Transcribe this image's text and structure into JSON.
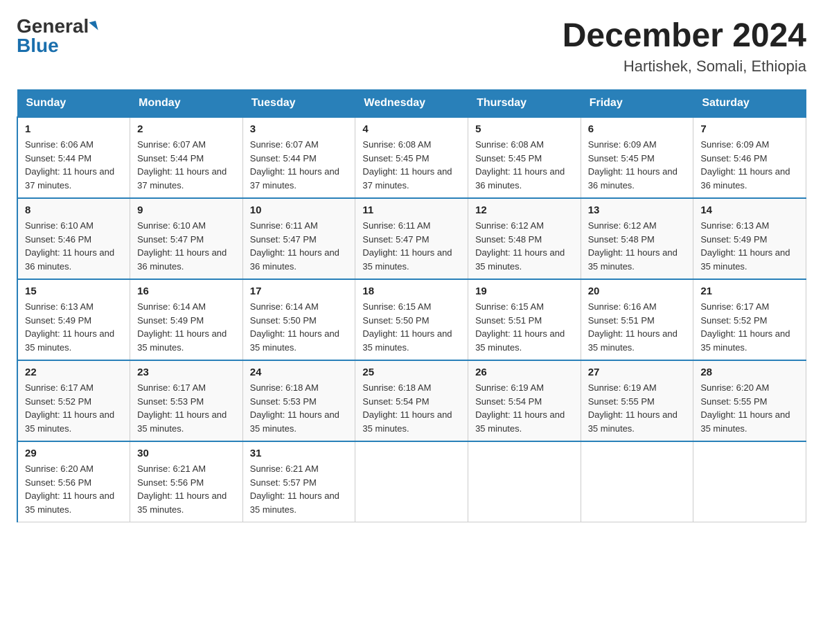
{
  "header": {
    "logo_general": "General",
    "logo_blue": "Blue",
    "month_title": "December 2024",
    "location": "Hartishek, Somali, Ethiopia"
  },
  "days_of_week": [
    "Sunday",
    "Monday",
    "Tuesday",
    "Wednesday",
    "Thursday",
    "Friday",
    "Saturday"
  ],
  "weeks": [
    [
      {
        "day": "1",
        "sunrise": "6:06 AM",
        "sunset": "5:44 PM",
        "daylight": "11 hours and 37 minutes."
      },
      {
        "day": "2",
        "sunrise": "6:07 AM",
        "sunset": "5:44 PM",
        "daylight": "11 hours and 37 minutes."
      },
      {
        "day": "3",
        "sunrise": "6:07 AM",
        "sunset": "5:44 PM",
        "daylight": "11 hours and 37 minutes."
      },
      {
        "day": "4",
        "sunrise": "6:08 AM",
        "sunset": "5:45 PM",
        "daylight": "11 hours and 37 minutes."
      },
      {
        "day": "5",
        "sunrise": "6:08 AM",
        "sunset": "5:45 PM",
        "daylight": "11 hours and 36 minutes."
      },
      {
        "day": "6",
        "sunrise": "6:09 AM",
        "sunset": "5:45 PM",
        "daylight": "11 hours and 36 minutes."
      },
      {
        "day": "7",
        "sunrise": "6:09 AM",
        "sunset": "5:46 PM",
        "daylight": "11 hours and 36 minutes."
      }
    ],
    [
      {
        "day": "8",
        "sunrise": "6:10 AM",
        "sunset": "5:46 PM",
        "daylight": "11 hours and 36 minutes."
      },
      {
        "day": "9",
        "sunrise": "6:10 AM",
        "sunset": "5:47 PM",
        "daylight": "11 hours and 36 minutes."
      },
      {
        "day": "10",
        "sunrise": "6:11 AM",
        "sunset": "5:47 PM",
        "daylight": "11 hours and 36 minutes."
      },
      {
        "day": "11",
        "sunrise": "6:11 AM",
        "sunset": "5:47 PM",
        "daylight": "11 hours and 35 minutes."
      },
      {
        "day": "12",
        "sunrise": "6:12 AM",
        "sunset": "5:48 PM",
        "daylight": "11 hours and 35 minutes."
      },
      {
        "day": "13",
        "sunrise": "6:12 AM",
        "sunset": "5:48 PM",
        "daylight": "11 hours and 35 minutes."
      },
      {
        "day": "14",
        "sunrise": "6:13 AM",
        "sunset": "5:49 PM",
        "daylight": "11 hours and 35 minutes."
      }
    ],
    [
      {
        "day": "15",
        "sunrise": "6:13 AM",
        "sunset": "5:49 PM",
        "daylight": "11 hours and 35 minutes."
      },
      {
        "day": "16",
        "sunrise": "6:14 AM",
        "sunset": "5:49 PM",
        "daylight": "11 hours and 35 minutes."
      },
      {
        "day": "17",
        "sunrise": "6:14 AM",
        "sunset": "5:50 PM",
        "daylight": "11 hours and 35 minutes."
      },
      {
        "day": "18",
        "sunrise": "6:15 AM",
        "sunset": "5:50 PM",
        "daylight": "11 hours and 35 minutes."
      },
      {
        "day": "19",
        "sunrise": "6:15 AM",
        "sunset": "5:51 PM",
        "daylight": "11 hours and 35 minutes."
      },
      {
        "day": "20",
        "sunrise": "6:16 AM",
        "sunset": "5:51 PM",
        "daylight": "11 hours and 35 minutes."
      },
      {
        "day": "21",
        "sunrise": "6:17 AM",
        "sunset": "5:52 PM",
        "daylight": "11 hours and 35 minutes."
      }
    ],
    [
      {
        "day": "22",
        "sunrise": "6:17 AM",
        "sunset": "5:52 PM",
        "daylight": "11 hours and 35 minutes."
      },
      {
        "day": "23",
        "sunrise": "6:17 AM",
        "sunset": "5:53 PM",
        "daylight": "11 hours and 35 minutes."
      },
      {
        "day": "24",
        "sunrise": "6:18 AM",
        "sunset": "5:53 PM",
        "daylight": "11 hours and 35 minutes."
      },
      {
        "day": "25",
        "sunrise": "6:18 AM",
        "sunset": "5:54 PM",
        "daylight": "11 hours and 35 minutes."
      },
      {
        "day": "26",
        "sunrise": "6:19 AM",
        "sunset": "5:54 PM",
        "daylight": "11 hours and 35 minutes."
      },
      {
        "day": "27",
        "sunrise": "6:19 AM",
        "sunset": "5:55 PM",
        "daylight": "11 hours and 35 minutes."
      },
      {
        "day": "28",
        "sunrise": "6:20 AM",
        "sunset": "5:55 PM",
        "daylight": "11 hours and 35 minutes."
      }
    ],
    [
      {
        "day": "29",
        "sunrise": "6:20 AM",
        "sunset": "5:56 PM",
        "daylight": "11 hours and 35 minutes."
      },
      {
        "day": "30",
        "sunrise": "6:21 AM",
        "sunset": "5:56 PM",
        "daylight": "11 hours and 35 minutes."
      },
      {
        "day": "31",
        "sunrise": "6:21 AM",
        "sunset": "5:57 PM",
        "daylight": "11 hours and 35 minutes."
      },
      null,
      null,
      null,
      null
    ]
  ]
}
